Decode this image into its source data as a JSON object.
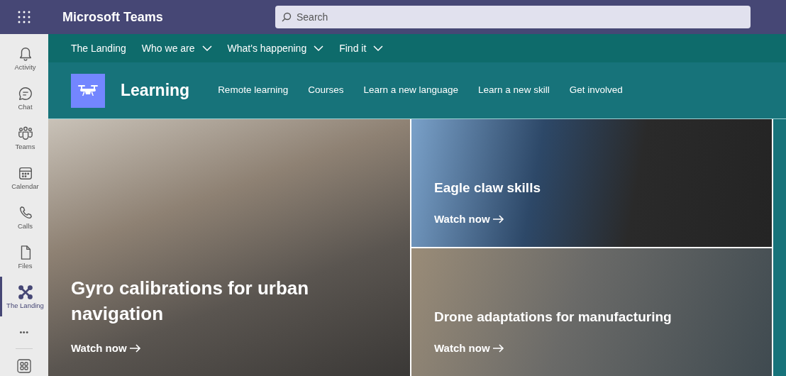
{
  "app_bar": {
    "title": "Microsoft Teams",
    "search": {
      "placeholder": "Search"
    }
  },
  "rail": [
    {
      "label": "Activity",
      "selected": false
    },
    {
      "label": "Chat",
      "selected": false
    },
    {
      "label": "Teams",
      "selected": false
    },
    {
      "label": "Calendar",
      "selected": false
    },
    {
      "label": "Calls",
      "selected": false
    },
    {
      "label": "Files",
      "selected": false
    },
    {
      "label": "The Landing",
      "selected": true
    }
  ],
  "rail_more": "•••",
  "site_nav": [
    {
      "label": "The Landing",
      "dropdown": false
    },
    {
      "label": "Who we are",
      "dropdown": true
    },
    {
      "label": "What's happening",
      "dropdown": true
    },
    {
      "label": "Find it",
      "dropdown": true
    }
  ],
  "site_header": {
    "title": "Learning",
    "links": [
      "Remote learning",
      "Courses",
      "Learn a new language",
      "Learn a new skill",
      "Get involved"
    ]
  },
  "tiles": [
    {
      "title": "Gyro calibrations for urban navigation",
      "link": "Watch now"
    },
    {
      "title": "Eagle claw skills",
      "link": "Watch now"
    },
    {
      "title": "Drone adaptations for manufacturing",
      "link": "Watch now"
    }
  ]
}
